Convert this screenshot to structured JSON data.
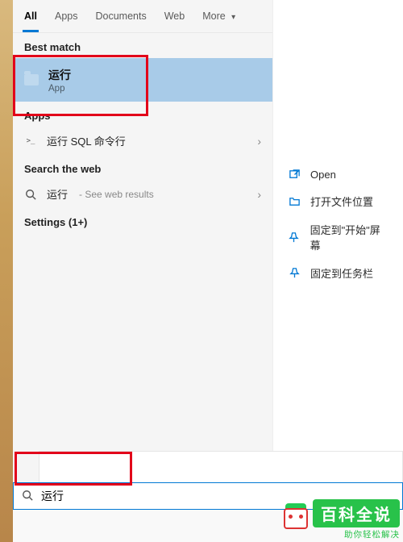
{
  "tabs": {
    "all": "All",
    "apps": "Apps",
    "documents": "Documents",
    "web": "Web",
    "more": "More"
  },
  "sections": {
    "bestMatch": "Best match",
    "apps": "Apps",
    "searchWeb": "Search the web",
    "settings": "Settings (1+)"
  },
  "bestMatch": {
    "title": "运行",
    "subtitle": "App"
  },
  "appResult": {
    "label": "运行 SQL 命令行"
  },
  "webResult": {
    "term": "运行",
    "suffix": "- See web results"
  },
  "actions": {
    "open": "Open",
    "openLocation": "打开文件位置",
    "pinStart": "固定到\"开始\"屏幕",
    "pinTaskbar": "固定到任务栏"
  },
  "searchBox": {
    "value": "运行"
  },
  "watermark": {
    "title": "百科全说",
    "subtitle": "助你轻松解决"
  }
}
